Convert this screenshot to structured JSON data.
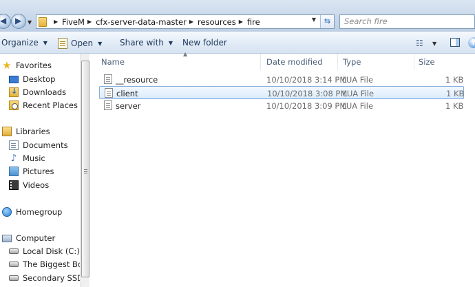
{
  "address": {
    "crumbs": [
      "FiveM",
      "cfx-server-data-master",
      "resources",
      "fire"
    ]
  },
  "search": {
    "placeholder": "Search fire"
  },
  "commands": {
    "organize": "Organize",
    "open": "Open",
    "share_with": "Share with",
    "new_folder": "New folder"
  },
  "nav": {
    "favorites": "Favorites",
    "desktop": "Desktop",
    "downloads": "Downloads",
    "recent_places": "Recent Places",
    "libraries": "Libraries",
    "documents": "Documents",
    "music": "Music",
    "pictures": "Pictures",
    "videos": "Videos",
    "homegroup": "Homegroup",
    "computer": "Computer",
    "local_disk": "Local Disk (C:)",
    "biggest_boy": "The Biggest Boy",
    "secondary_ssd": "Secondary SSD (E"
  },
  "columns": {
    "name": "Name",
    "date_modified": "Date modified",
    "type": "Type",
    "size": "Size"
  },
  "files": [
    {
      "name": "__resource",
      "date": "10/10/2018 3:14 PM",
      "type": "LUA File",
      "size": "1 KB"
    },
    {
      "name": "client",
      "date": "10/10/2018 3:08 PM",
      "type": "LUA File",
      "size": "1 KB"
    },
    {
      "name": "server",
      "date": "10/10/2018 3:09 PM",
      "type": "LUA File",
      "size": "1 KB"
    }
  ]
}
